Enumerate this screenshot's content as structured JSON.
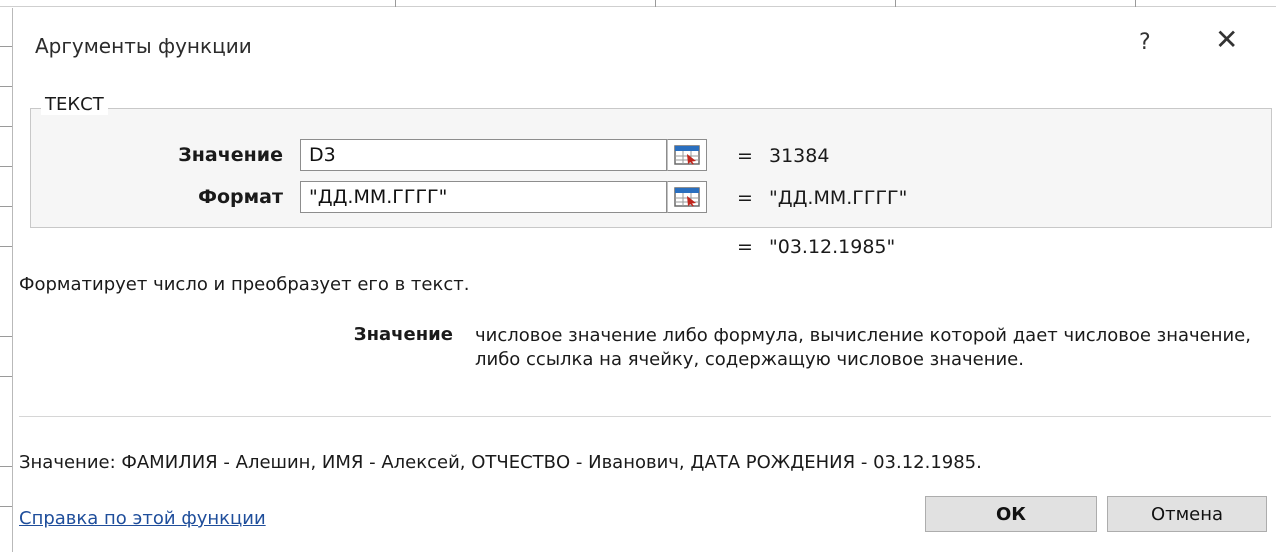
{
  "dialog": {
    "title": "Аргументы функции",
    "help_glyph": "?",
    "close_glyph": "✕"
  },
  "function_group": {
    "name": "ТЕКСТ",
    "args": [
      {
        "label": "Значение",
        "value": "D3",
        "result_eq": "=",
        "result": "31384",
        "button_icon": "collapse-dialog-icon"
      },
      {
        "label": "Формат",
        "value": "\"ДД.ММ.ГГГГ\"",
        "result_eq": "=",
        "result": "\"ДД.ММ.ГГГГ\"",
        "button_icon": "collapse-dialog-icon"
      }
    ]
  },
  "overall": {
    "eq": "=",
    "value": "\"03.12.1985\""
  },
  "description": "Форматирует число и преобразует его в текст.",
  "arg_help": {
    "label": "Значение",
    "text": "числовое значение либо формула, вычисление которой дает числовое значение, либо ссылка на ячейку, содержащую числовое значение."
  },
  "result_line": "Значение:   ФАМИЛИЯ - Алешин, ИМЯ - Алексей, ОТЧЕСТВО - Иванович, ДАТА РОЖДЕНИЯ - 03.12.1985.",
  "help_link": "Справка по этой функции",
  "buttons": {
    "ok": "ОК",
    "cancel": "Отмена"
  },
  "colors": {
    "link": "#1f4e9b",
    "button_face": "#e1e1e1",
    "group_bg": "#f6f6f6"
  }
}
